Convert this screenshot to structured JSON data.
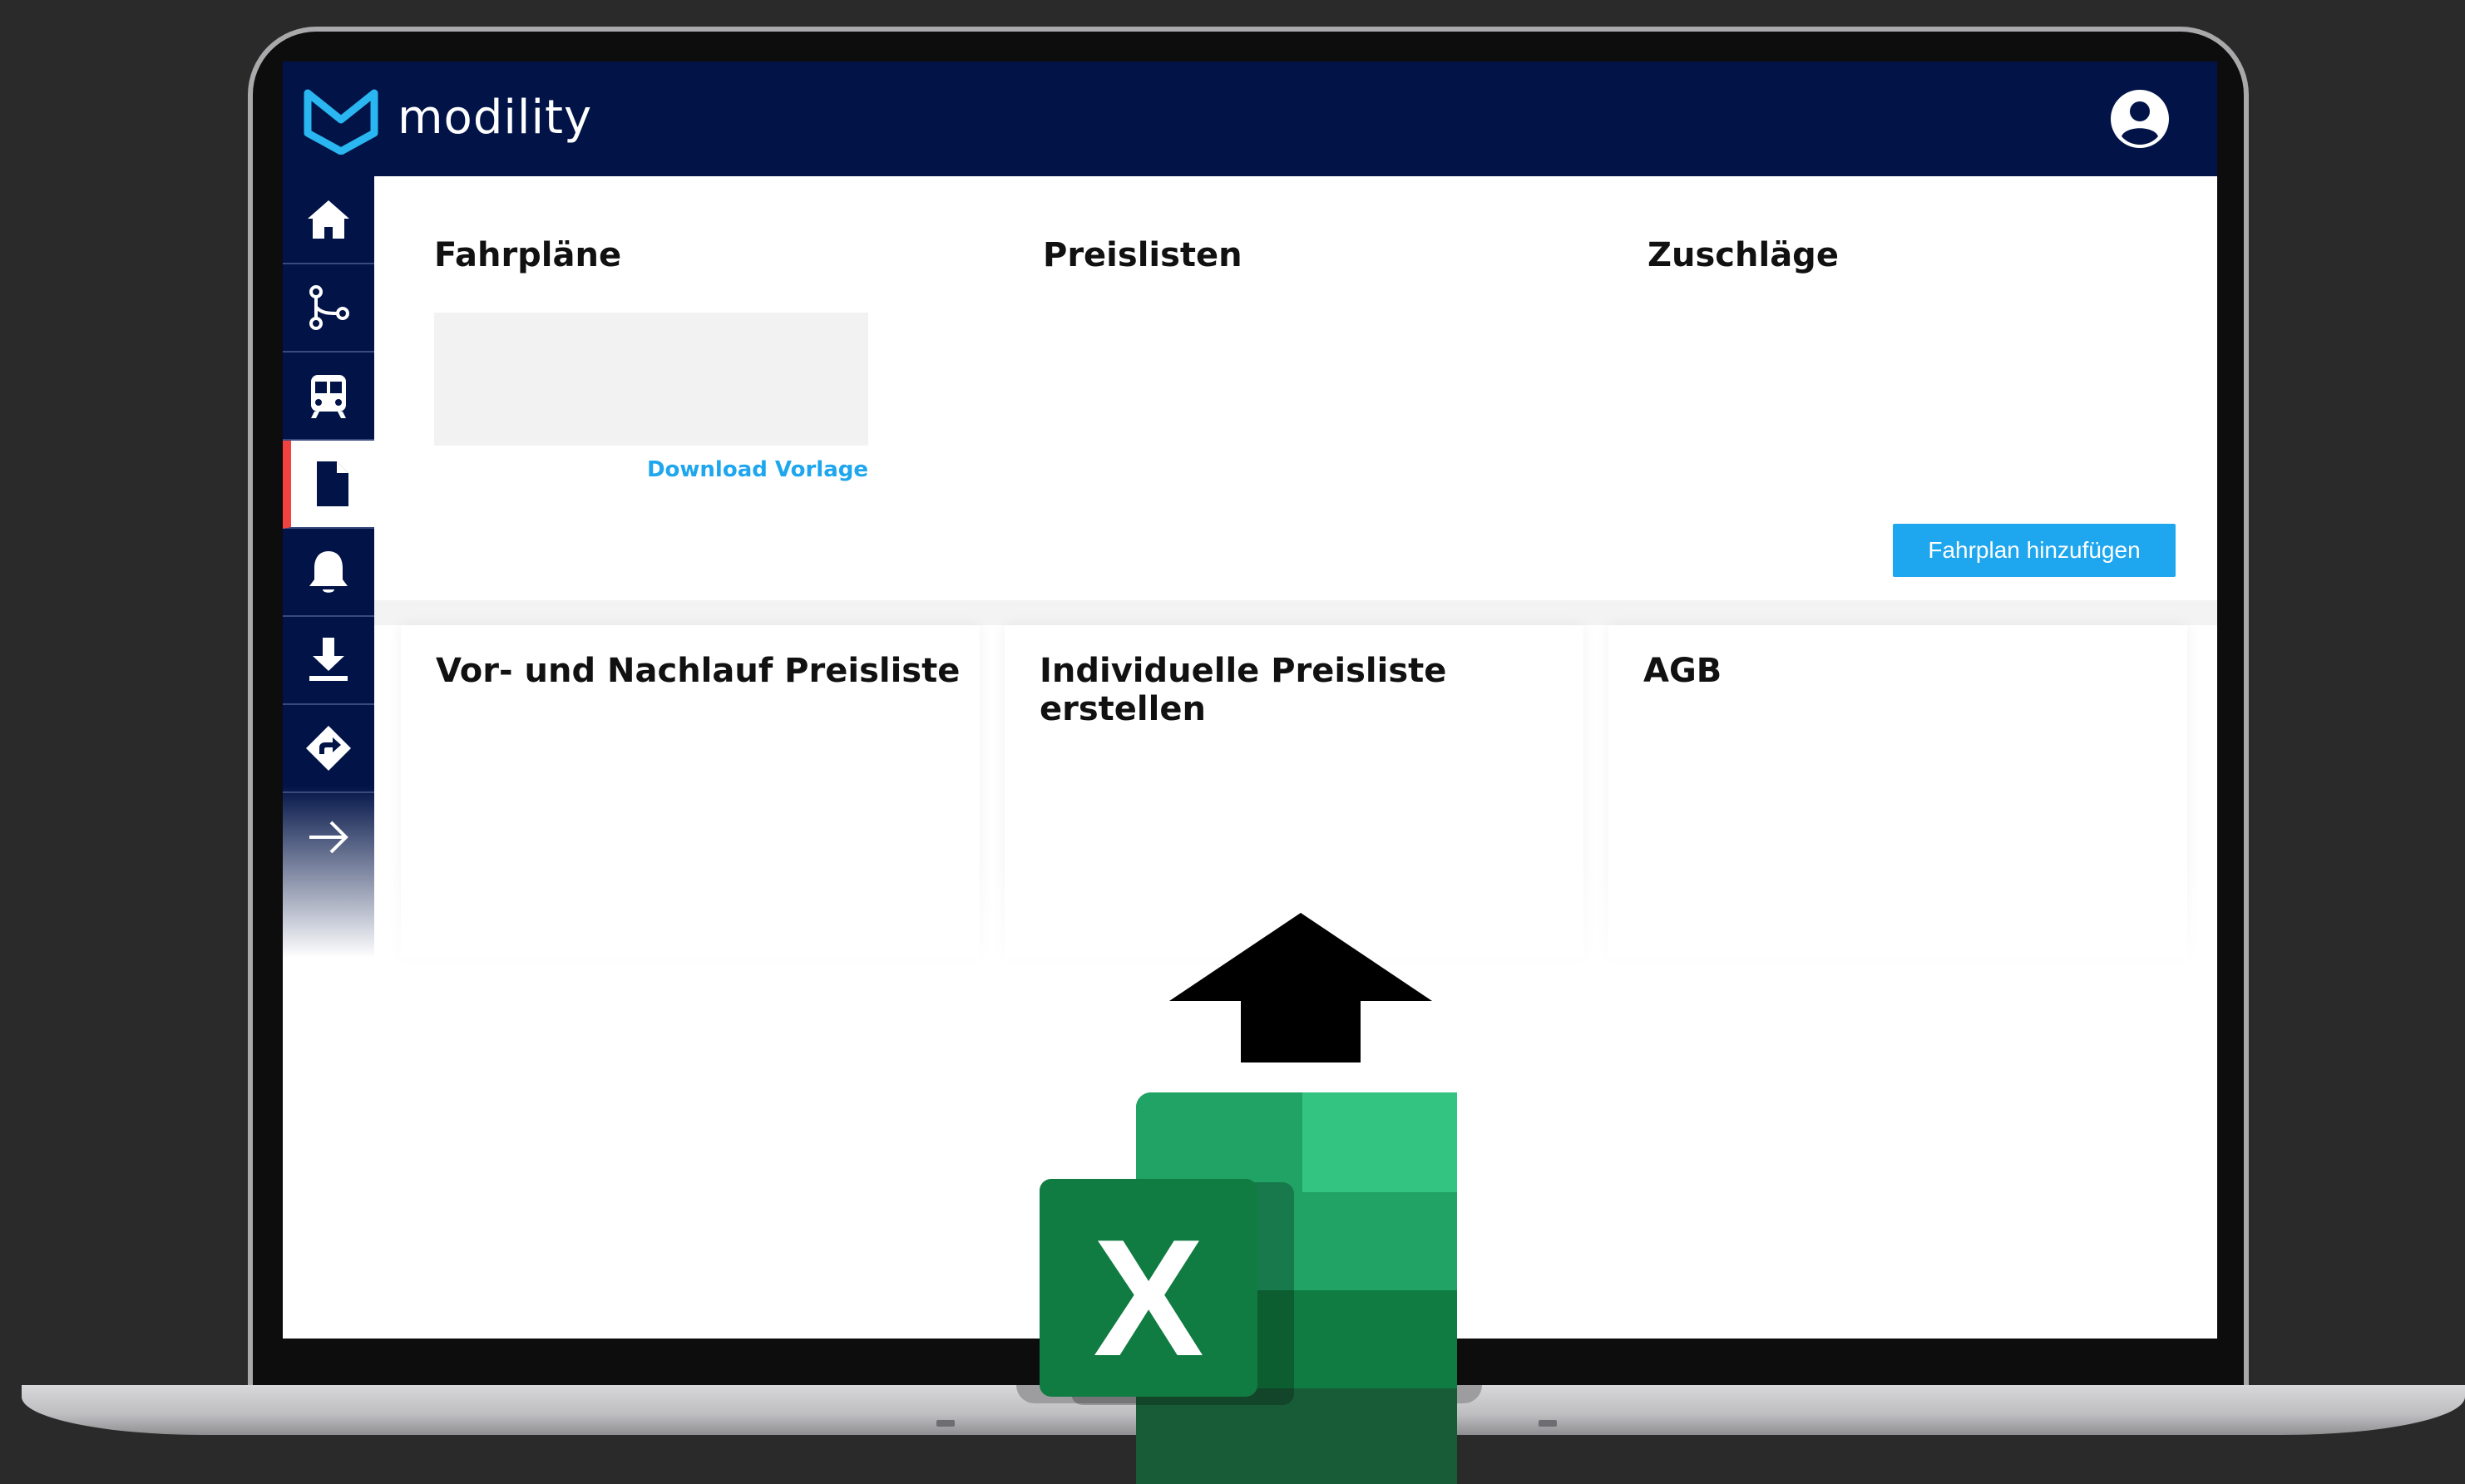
{
  "app": {
    "brand": "modility",
    "colors": {
      "topbar": "#011347",
      "accent": "#1ea6ee",
      "active_marker": "#f0423f"
    }
  },
  "sidebar": {
    "items": [
      {
        "name": "home",
        "icon": "home-icon"
      },
      {
        "name": "routes",
        "icon": "route-icon"
      },
      {
        "name": "trains",
        "icon": "train-icon"
      },
      {
        "name": "documents",
        "icon": "document-icon",
        "active": true
      },
      {
        "name": "notifications",
        "icon": "bell-icon"
      },
      {
        "name": "downloads",
        "icon": "download-icon"
      },
      {
        "name": "directions",
        "icon": "directions-icon"
      },
      {
        "name": "expand",
        "icon": "arrow-right-icon"
      }
    ]
  },
  "main": {
    "sections": {
      "fahrplaene": "Fahrpläne",
      "preislisten": "Preislisten",
      "zuschlaege": "Zuschläge"
    },
    "download_link": "Download Vorlage",
    "add_button": "Fahrplan hinzufügen",
    "cards": [
      {
        "title": "Vor- und Nachlauf Preisliste"
      },
      {
        "title": "Individuelle Preisliste erstellen"
      },
      {
        "title": "AGB"
      }
    ]
  },
  "overlay": {
    "arrow_icon": "upload-arrow-icon",
    "excel_icon": "excel-icon",
    "excel_letter": "X"
  }
}
